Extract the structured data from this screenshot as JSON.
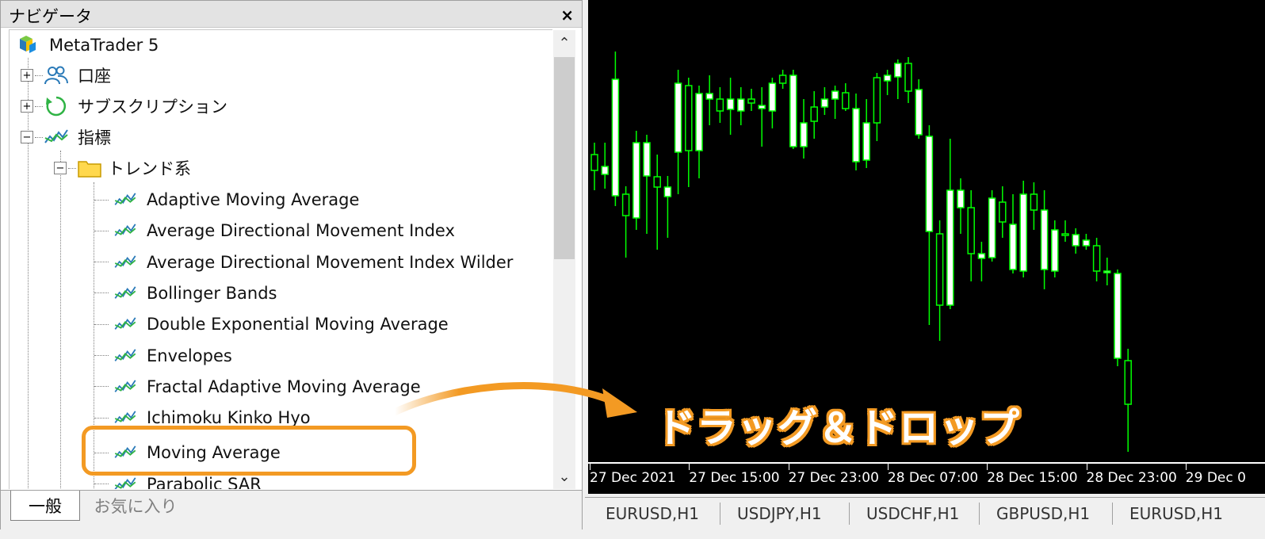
{
  "navigator": {
    "title": "ナビゲータ",
    "close": "×",
    "tree": {
      "root": "MetaTrader 5",
      "accounts": "口座",
      "subscriptions": "サブスクリプション",
      "indicators": "指標",
      "trend_folder": "トレンド系",
      "items": [
        "Adaptive Moving Average",
        "Average Directional Movement Index",
        "Average Directional Movement Index Wilder",
        "Bollinger Bands",
        "Double Exponential Moving Average",
        "Envelopes",
        "Fractal Adaptive Moving Average",
        "Ichimoku Kinko Hyo",
        "Moving Average",
        "Parabolic SAR"
      ]
    },
    "tabs": {
      "general": "一般",
      "favorites": "お気に入り"
    },
    "scroll_up": "⌃",
    "scroll_down": "⌄"
  },
  "chart": {
    "background": "#000000",
    "bull_color": "#00ff00",
    "x_ticks": [
      "27 Dec 2021",
      "27 Dec 15:00",
      "27 Dec 23:00",
      "28 Dec 07:00",
      "28 Dec 15:00",
      "28 Dec 23:00",
      "29 Dec 0"
    ],
    "symbol_tabs": [
      "EURUSD,H1",
      "USDJPY,H1",
      "USDCHF,H1",
      "GBPUSD,H1",
      "EURUSD,H1"
    ]
  },
  "annotation": {
    "label": "ドラッグ＆ドロップ",
    "color": "#f39a23"
  }
}
